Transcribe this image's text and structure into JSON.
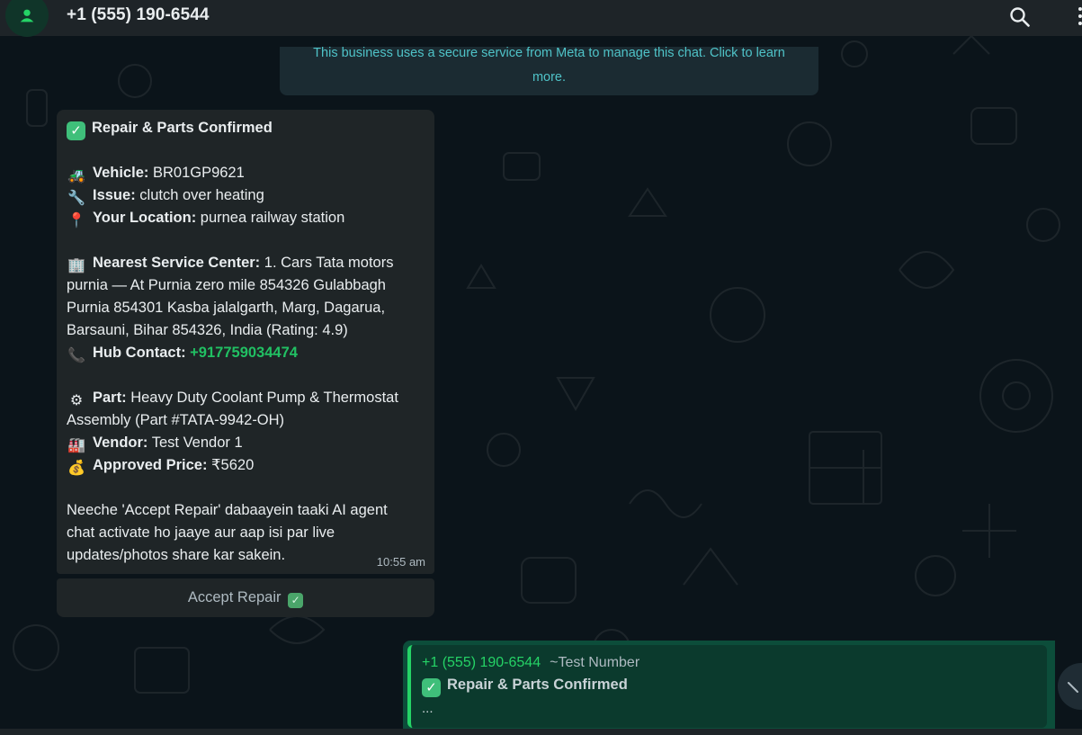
{
  "header": {
    "contact_name": "+1 (555) 190-6544",
    "avatar_icon": "user-avatar-icon",
    "search_icon": "search-icon"
  },
  "banner": {
    "text": "This business uses a secure service from Meta to manage this chat. Click to learn more."
  },
  "message": {
    "title": "Repair & Parts Confirmed",
    "vehicle_label": "Vehicle:",
    "vehicle_value": "BR01GP9621",
    "issue_label": "Issue:",
    "issue_value": "clutch over heating",
    "location_label": "Your Location:",
    "location_value": "purnea railway station",
    "service_center_label": "Nearest Service Center:",
    "service_center_line1": "1. Cars Tata motors",
    "service_center_line2": "purnia — At Purnia zero mile 854326 Gulabbagh",
    "service_center_line3": "Purnia 854301 Kasba jalalgarth, Marg, Dagarua,",
    "service_center_line4": "Barsauni, Bihar 854326, India (Rating: 4.9)",
    "hub_contact_label": "Hub Contact:",
    "hub_contact_value": "+917759034474",
    "part_label": "Part:",
    "part_line1": "Heavy Duty Coolant Pump & Thermostat",
    "part_line2": "Assembly (Part #TATA-9942-OH)",
    "vendor_label": "Vendor:",
    "vendor_value": "Test Vendor 1",
    "price_label": "Approved Price:",
    "price_value": "₹5620",
    "footer_line1": "Neeche 'Accept Repair' dabaayein taaki AI agent",
    "footer_line2": "chat activate ho jaaye aur aap isi par live",
    "footer_line3": "updates/photos share kar sakein.",
    "time": "10:55 am",
    "emojis": {
      "title": "✓",
      "vehicle": "🚜",
      "issue": "🔧",
      "location": "📍",
      "service_center": "🏢",
      "hub_contact": "📞",
      "part": "⚙",
      "vendor": "🏭",
      "price": "💰"
    }
  },
  "accept_button": {
    "label": "Accept Repair",
    "check": "✓"
  },
  "reply_preview": {
    "sender": "+1 (555) 190-6544",
    "push_name": "~Test Number",
    "title": "Repair & Parts Confirmed",
    "title_check": "✓",
    "ellipsis": "..."
  },
  "colors": {
    "background": "#0b141a",
    "header": "#1e2428",
    "incoming_bubble": "#1f2527",
    "outgoing_bubble": "#0c4d3a",
    "accent_green": "#25d366",
    "link_green": "#21c063",
    "banner_text": "#4fc3c8"
  }
}
